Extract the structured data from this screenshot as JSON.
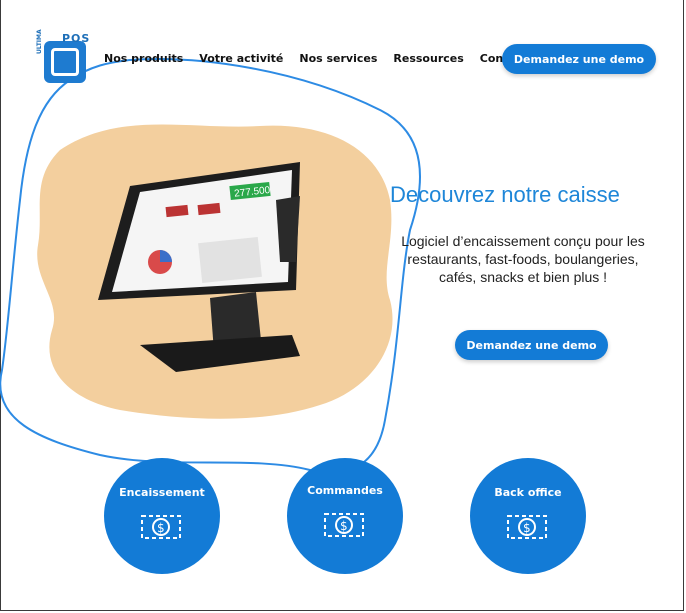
{
  "logo": {
    "text": "POS",
    "side_text": "ULTIMA"
  },
  "nav": {
    "items": [
      "Nos produits",
      "Votre activité",
      "Nos services",
      "Ressources",
      "Contact"
    ]
  },
  "header": {
    "cta_label": "Demandez une demo"
  },
  "hero": {
    "title": "Decouvrez notre caisse",
    "description": "Logiciel d’encaissement conçu pour les restaurants, fast-foods, boulangeries, cafés, snacks et bien plus !",
    "cta_label": "Demandez une demo",
    "screen_amount": "277.500"
  },
  "services": [
    {
      "label": "Encaissement",
      "icon": "money-icon"
    },
    {
      "label": "Commandes",
      "icon": "money-icon"
    },
    {
      "label": "Back office",
      "icon": "money-icon"
    }
  ],
  "colors": {
    "accent": "#137bd6",
    "title": "#1e86d8",
    "blob": "#f3cf9e",
    "outline": "#2d8be4"
  }
}
